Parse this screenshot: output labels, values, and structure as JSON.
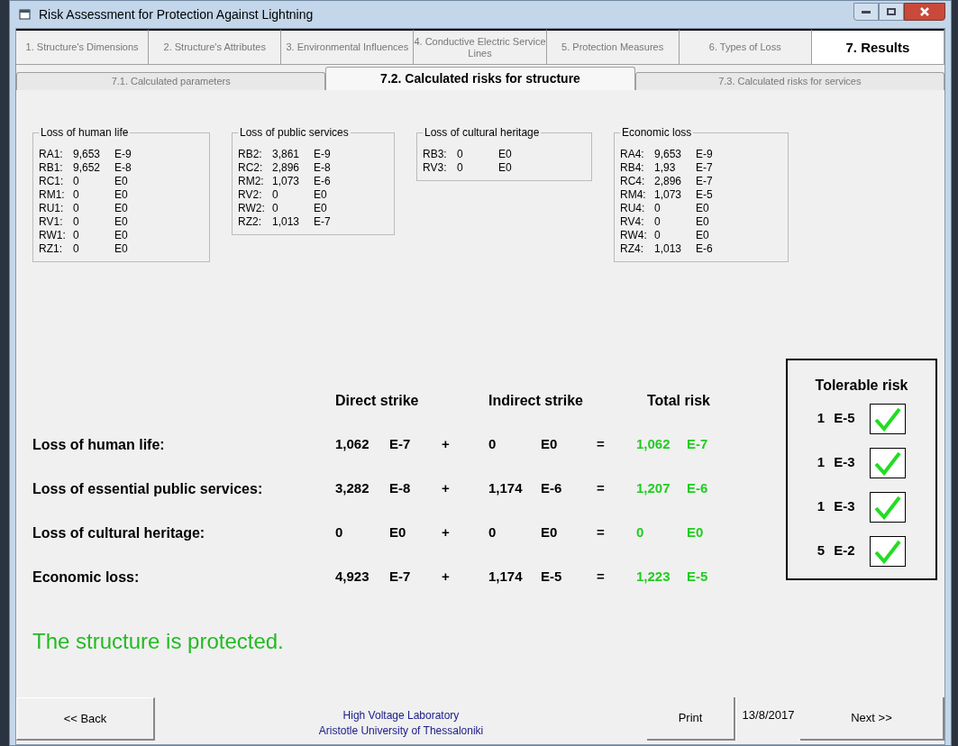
{
  "window": {
    "title": "Risk Assessment for Protection Against Lightning"
  },
  "tabs": [
    {
      "label": "1. Structure's Dimensions",
      "selected": false
    },
    {
      "label": "2. Structure's Attributes",
      "selected": false
    },
    {
      "label": "3. Environmental Influences",
      "selected": false
    },
    {
      "label": "4. Conductive Electric Service Lines",
      "selected": false
    },
    {
      "label": "5. Protection Measures",
      "selected": false
    },
    {
      "label": "6. Types of Loss",
      "selected": false
    },
    {
      "label": "7. Results",
      "selected": true
    }
  ],
  "subtabs": [
    {
      "label": "7.1. Calculated parameters",
      "selected": false
    },
    {
      "label": "7.2. Calculated risks for structure",
      "selected": true
    },
    {
      "label": "7.3. Calculated risks for services",
      "selected": false
    }
  ],
  "groups": [
    {
      "title": "Loss of human life",
      "rows": [
        [
          "RA1:",
          "9,653",
          "E-9"
        ],
        [
          "RB1:",
          "9,652",
          "E-8"
        ],
        [
          "RC1:",
          "0",
          "E0"
        ],
        [
          "RM1:",
          "0",
          "E0"
        ],
        [
          "RU1:",
          "0",
          "E0"
        ],
        [
          "RV1:",
          "0",
          "E0"
        ],
        [
          "RW1:",
          "0",
          "E0"
        ],
        [
          "RZ1:",
          "0",
          "E0"
        ]
      ]
    },
    {
      "title": "Loss of public services",
      "rows": [
        [
          "RB2:",
          "3,861",
          "E-9"
        ],
        [
          "RC2:",
          "2,896",
          "E-8"
        ],
        [
          "RM2:",
          "1,073",
          "E-6"
        ],
        [
          "RV2:",
          "0",
          "E0"
        ],
        [
          "RW2:",
          "0",
          "E0"
        ],
        [
          "RZ2:",
          "1,013",
          "E-7"
        ]
      ]
    },
    {
      "title": "Loss of cultural heritage",
      "rows": [
        [
          "RB3:",
          "0",
          "E0"
        ],
        [
          "RV3:",
          "0",
          "E0"
        ]
      ]
    },
    {
      "title": "Economic loss",
      "rows": [
        [
          "RA4:",
          "9,653",
          "E-9"
        ],
        [
          "RB4:",
          "1,93",
          "E-7"
        ],
        [
          "RC4:",
          "2,896",
          "E-7"
        ],
        [
          "RM4:",
          "1,073",
          "E-5"
        ],
        [
          "RU4:",
          "0",
          "E0"
        ],
        [
          "RV4:",
          "0",
          "E0"
        ],
        [
          "RW4:",
          "0",
          "E0"
        ],
        [
          "RZ4:",
          "1,013",
          "E-6"
        ]
      ]
    }
  ],
  "results": {
    "headers": {
      "direct": "Direct strike",
      "indirect": "Indirect strike",
      "total": "Total risk",
      "tolerable": "Tolerable risk"
    },
    "rows": [
      {
        "label": "Loss of human life:",
        "direct": [
          "1,062",
          "E-7"
        ],
        "plus": "+",
        "indirect": [
          "0",
          "E0"
        ],
        "equals": "=",
        "total": [
          "1,062",
          "E-7"
        ],
        "tolerable": [
          "1",
          "E-5"
        ],
        "checked": true
      },
      {
        "label": "Loss of essential public services:",
        "direct": [
          "3,282",
          "E-8"
        ],
        "plus": "+",
        "indirect": [
          "1,174",
          "E-6"
        ],
        "equals": "=",
        "total": [
          "1,207",
          "E-6"
        ],
        "tolerable": [
          "1",
          "E-3"
        ],
        "checked": true
      },
      {
        "label": "Loss of cultural heritage:",
        "direct": [
          "0",
          "E0"
        ],
        "plus": "+",
        "indirect": [
          "0",
          "E0"
        ],
        "equals": "=",
        "total": [
          "0",
          "E0"
        ],
        "tolerable": [
          "1",
          "E-3"
        ],
        "checked": true
      },
      {
        "label": "Economic loss:",
        "direct": [
          "4,923",
          "E-7"
        ],
        "plus": "+",
        "indirect": [
          "1,174",
          "E-5"
        ],
        "equals": "=",
        "total": [
          "1,223",
          "E-5"
        ],
        "tolerable": [
          "5",
          "E-2"
        ],
        "checked": true
      }
    ]
  },
  "verdict": "The structure is protected.",
  "footer": {
    "back": "<< Back",
    "credit": [
      "High Voltage Laboratory",
      "Aristotle University of Thessaloniki"
    ],
    "print": "Print",
    "date": "13/8/2017",
    "next": "Next >>"
  }
}
